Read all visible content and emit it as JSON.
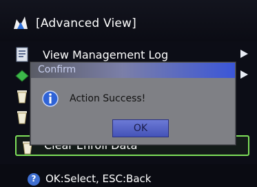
{
  "header": {
    "title": "[Advanced View]",
    "icon": "user-group-icon"
  },
  "menu": {
    "items": [
      {
        "label": "View Management Log",
        "icon": "log-icon",
        "has_submenu": true
      },
      {
        "label": "",
        "icon": "card-icon",
        "has_submenu": true
      },
      {
        "label": "",
        "icon": "trash-icon",
        "has_submenu": false
      },
      {
        "label": "",
        "icon": "trash-icon",
        "has_submenu": false
      },
      {
        "label": "Clear Enroll Data",
        "icon": "trash-icon",
        "has_submenu": false,
        "selected": true
      }
    ]
  },
  "dialog": {
    "title": "Confirm",
    "message": "Action Success!",
    "ok_label": "OK",
    "icon": "info-icon"
  },
  "footer": {
    "hint": "OK:Select, ESC:Back",
    "icon_glyph": "?",
    "icon": "help-icon"
  },
  "colors": {
    "selection_border": "#7ee05a",
    "dialog_bg": "#7f8085",
    "title_bar_accent": "#3b56d8",
    "ok_button": "#5563c8"
  }
}
